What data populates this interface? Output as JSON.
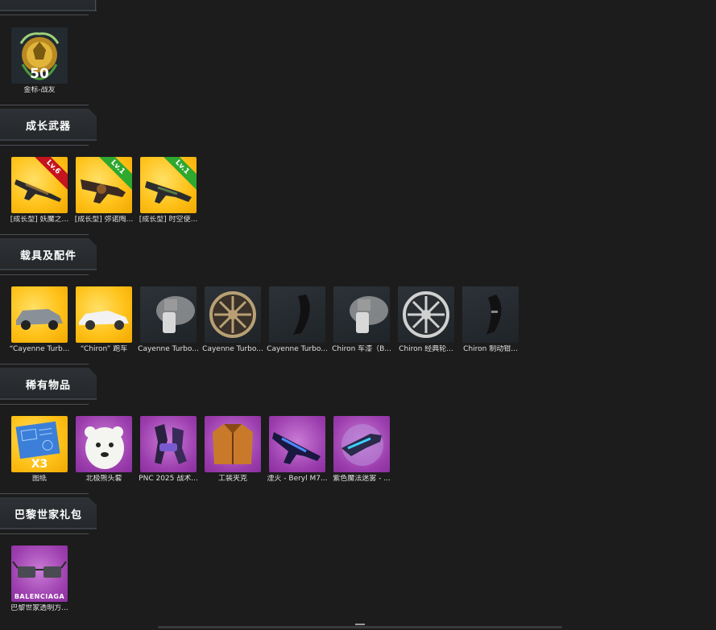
{
  "sections": {
    "medals": {
      "title": ""
    },
    "growth_weapons": {
      "title": "成长武器"
    },
    "vehicles": {
      "title": "载具及配件"
    },
    "rare_items": {
      "title": "稀有物品"
    },
    "paris_gift": {
      "title": "巴黎世家礼包"
    }
  },
  "medal_item": {
    "caption": "金标-战友",
    "level": "50"
  },
  "weapon_items": [
    {
      "caption": "[成长型] 妖魔之...",
      "badge": "Lv.6",
      "badge_color": "#c4141c"
    },
    {
      "caption": "[成长型] 弥诺陶...",
      "badge": "Lv.1",
      "badge_color": "#2ea82e"
    },
    {
      "caption": "[成长型] 时空使...",
      "badge": "Lv.1",
      "badge_color": "#2ea82e"
    }
  ],
  "vehicle_items": [
    {
      "caption": "“Cayenne Turb...",
      "icon": "suv-car-icon",
      "bg": "gold"
    },
    {
      "caption": "“Chiron” 跑车",
      "icon": "sports-car-icon",
      "bg": "gold"
    },
    {
      "caption": "Cayenne Turbo...",
      "icon": "paint-sprayer-icon",
      "bg": "dark"
    },
    {
      "caption": "Cayenne Turbo...",
      "icon": "wheel-rim-icon",
      "bg": "dark"
    },
    {
      "caption": "Cayenne Turbo...",
      "icon": "brake-caliper-icon",
      "bg": "dark"
    },
    {
      "caption": "Chiron 车漆（B...",
      "icon": "paint-sprayer-icon",
      "bg": "dark"
    },
    {
      "caption": "Chiron 经典轮...",
      "icon": "wheel-rim-icon",
      "bg": "dark"
    },
    {
      "caption": "Chiron 制动钳...",
      "icon": "brake-caliper-icon",
      "bg": "dark"
    }
  ],
  "rare_items": [
    {
      "caption": "图纸",
      "icon": "blueprint-icon",
      "bg": "gold",
      "overlay": "X3"
    },
    {
      "caption": "北极熊头套",
      "icon": "polar-bear-mask-icon",
      "bg": "purple",
      "overlay": ""
    },
    {
      "caption": "PNC 2025 战术...",
      "icon": "tactical-gear-icon",
      "bg": "purple",
      "overlay": ""
    },
    {
      "caption": "工装夹克",
      "icon": "jacket-icon",
      "bg": "purple",
      "overlay": ""
    },
    {
      "caption": "湮灭 - Beryl M7...",
      "icon": "rifle-icon",
      "bg": "purple",
      "overlay": ""
    },
    {
      "caption": "紫色魔法迷雾 - ...",
      "icon": "magic-gun-icon",
      "bg": "purple",
      "overlay": ""
    }
  ],
  "paris_items": [
    {
      "caption": "巴黎世家透明方...",
      "icon": "sunglasses-icon",
      "bg": "purple",
      "overlay": "BALENCIAGA"
    }
  ]
}
